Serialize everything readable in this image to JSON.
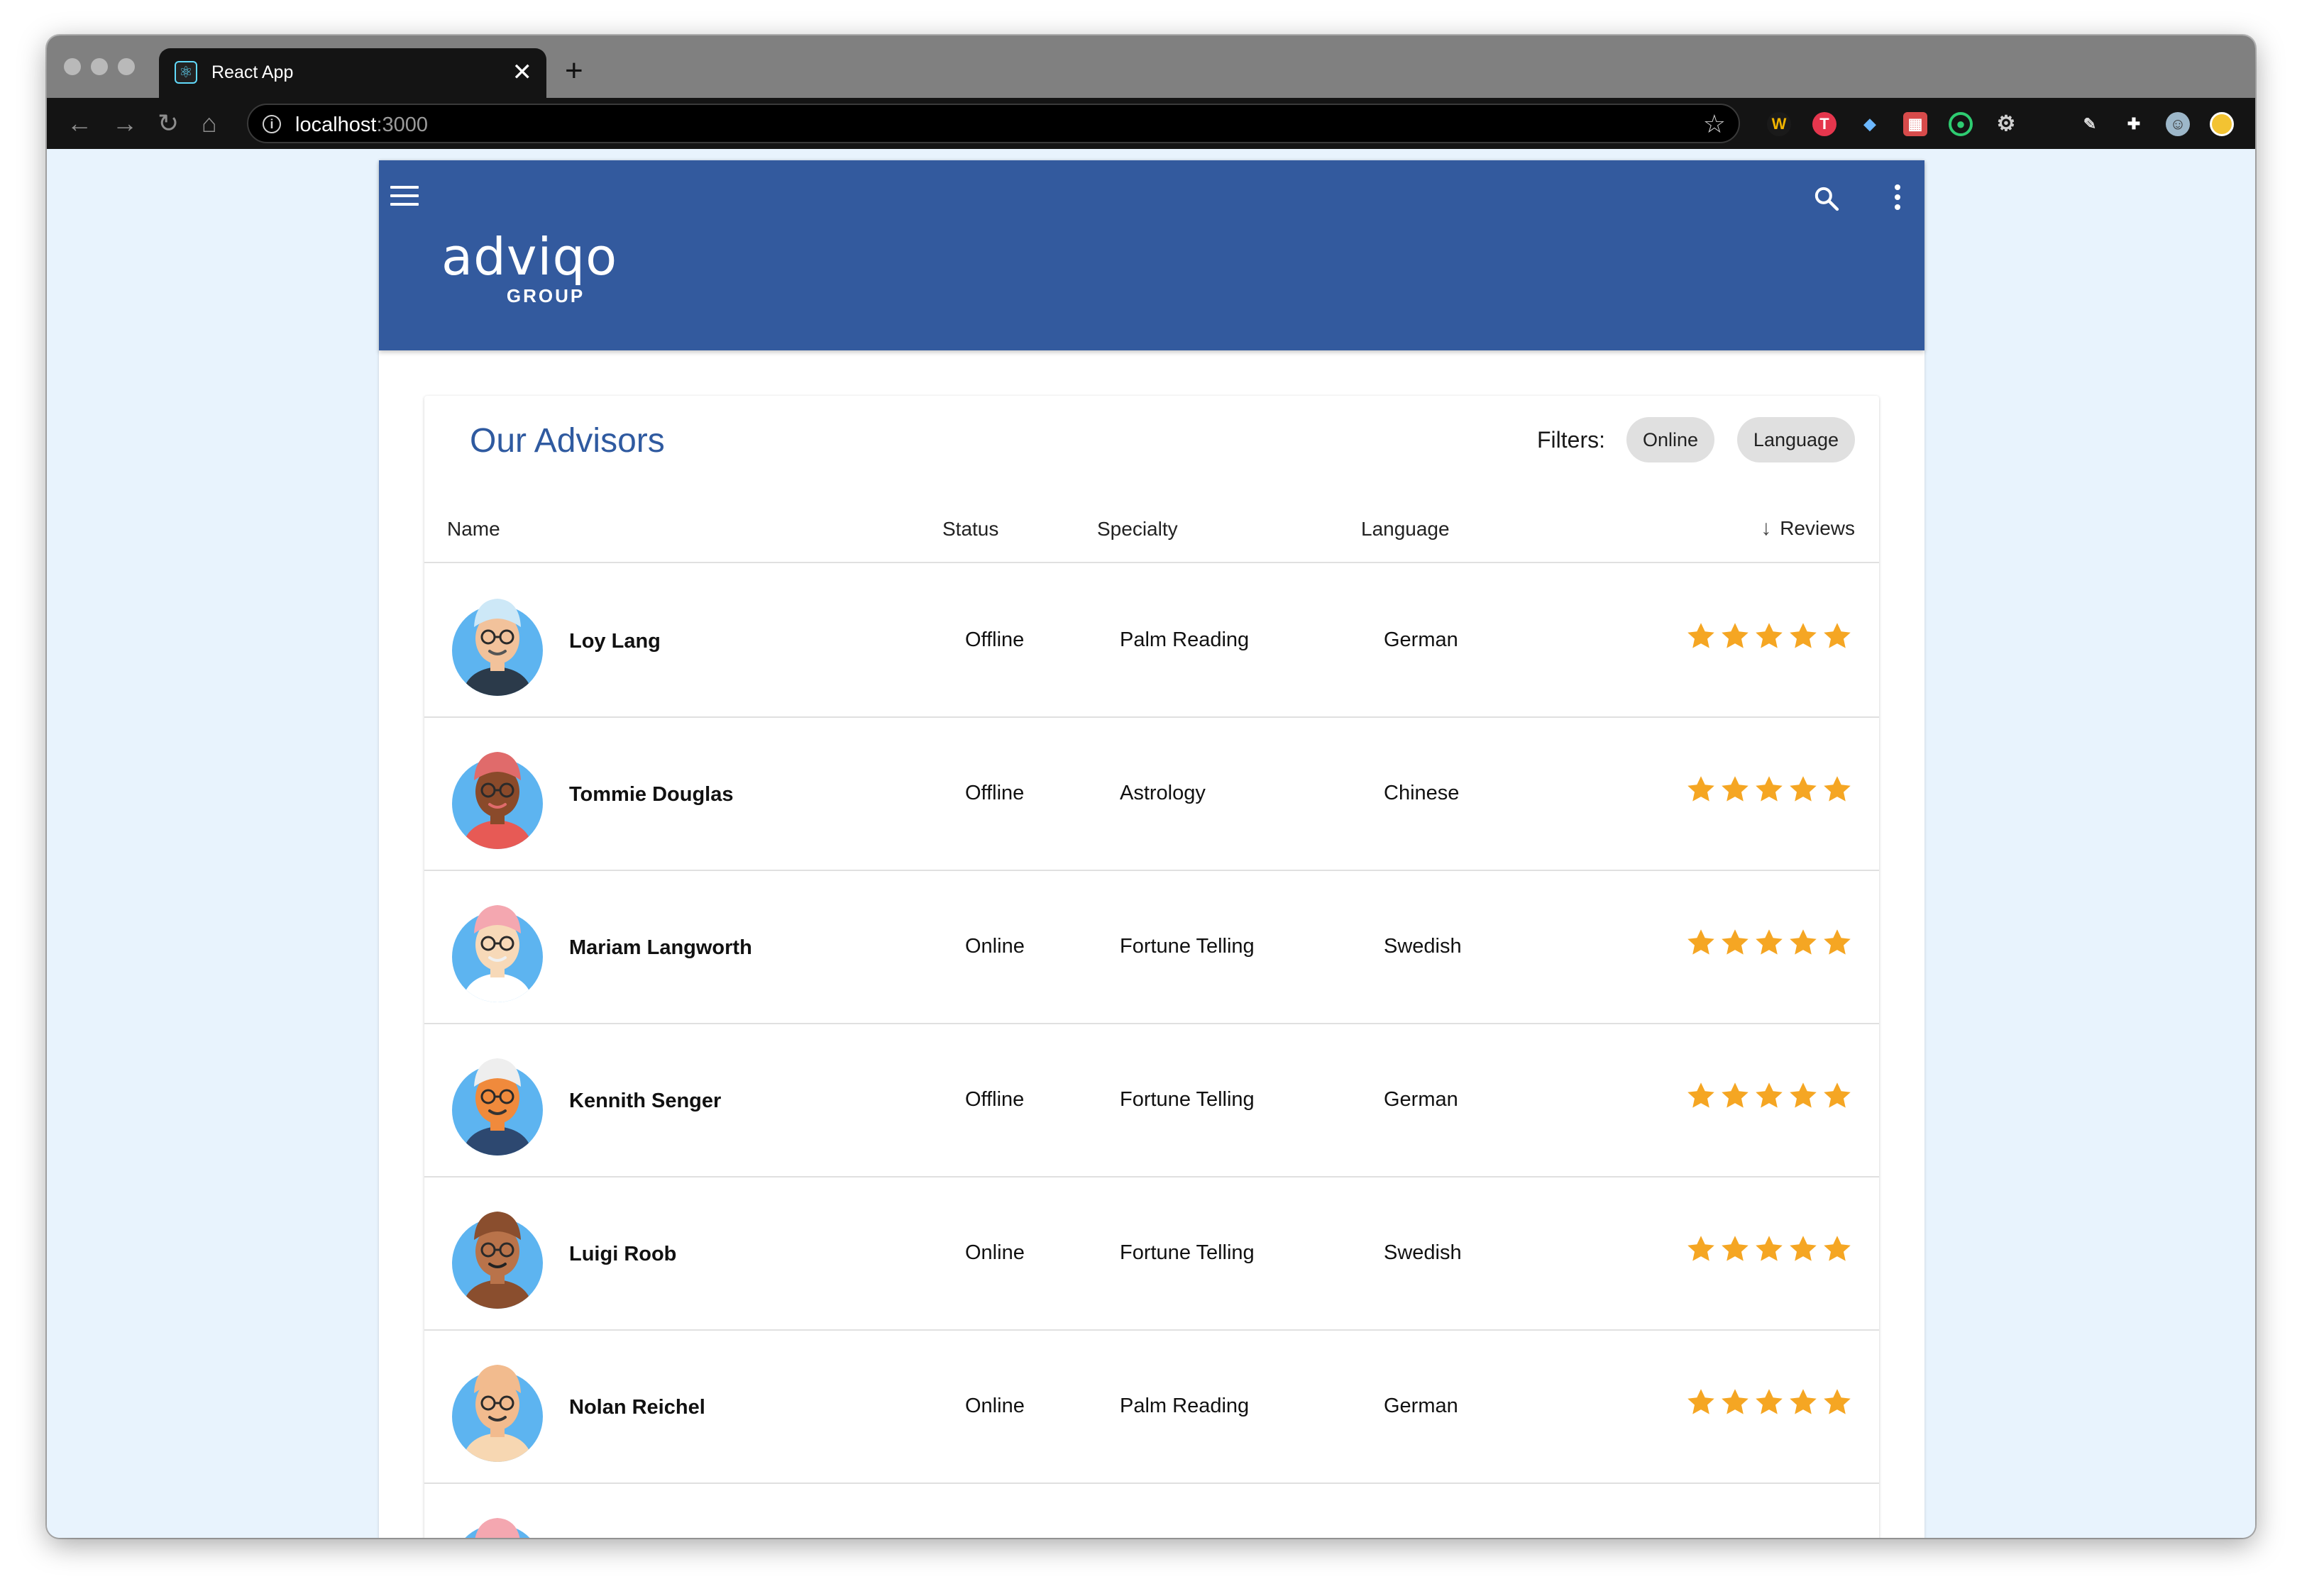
{
  "browser": {
    "tab_title": "React App",
    "tab_close": "✕",
    "new_tab": "+",
    "url_host": "localhost",
    "url_port": ":3000",
    "nav": {
      "back": "←",
      "forward": "→",
      "reload": "↻",
      "home": "⌂"
    }
  },
  "app": {
    "logo_main": "adviqo",
    "logo_sub": "GROUP"
  },
  "card": {
    "title": "Our Advisors",
    "filters_label": "Filters:",
    "chips": [
      "Online",
      "Language"
    ]
  },
  "table": {
    "headers": {
      "name": "Name",
      "status": "Status",
      "specialty": "Specialty",
      "language": "Language",
      "reviews": "Reviews"
    },
    "rows": [
      {
        "name": "Loy Lang",
        "status": "Offline",
        "specialty": "Palm Reading",
        "language": "German",
        "stars": 5,
        "skin": "#f2c29b",
        "hat": "#cde8f7",
        "shirt": "#2b3a4a",
        "hair": "#555555"
      },
      {
        "name": "Tommie Douglas",
        "status": "Offline",
        "specialty": "Astrology",
        "language": "Chinese",
        "stars": 5,
        "skin": "#8a4a2a",
        "hat": "#e06b6b",
        "shirt": "#e75a55",
        "hair": "#e06b6b"
      },
      {
        "name": "Mariam Langworth",
        "status": "Online",
        "specialty": "Fortune Telling",
        "language": "Swedish",
        "stars": 5,
        "skin": "#f7d9b8",
        "hat": "#f4a7b0",
        "shirt": "#ffffff",
        "hair": "#f0f0f0"
      },
      {
        "name": "Kennith Senger",
        "status": "Offline",
        "specialty": "Fortune Telling",
        "language": "German",
        "stars": 5,
        "skin": "#f08a3c",
        "hat": "#eeeeee",
        "shirt": "#2d4870",
        "hair": "#333333"
      },
      {
        "name": "Luigi Roob",
        "status": "Online",
        "specialty": "Fortune Telling",
        "language": "Swedish",
        "stars": 5,
        "skin": "#b9734a",
        "hat": "#8a4e2e",
        "shirt": "#8a4e2e",
        "hair": "#222222"
      },
      {
        "name": "Nolan Reichel",
        "status": "Online",
        "specialty": "Palm Reading",
        "language": "German",
        "stars": 5,
        "skin": "#f2bb8e",
        "hat": "#f2bb8e",
        "shirt": "#f7d7b2",
        "hair": "#333333"
      },
      {
        "name": "",
        "status": "",
        "specialty": "",
        "language": "",
        "stars": 0,
        "skin": "#f7d9b8",
        "hat": "#f4a7b0",
        "shirt": "#ffffff",
        "hair": "#f4a7b0"
      }
    ]
  },
  "colors": {
    "appbar": "#335a9e",
    "title": "#2f5aa0",
    "star": "#f5a623",
    "avatar_bg": "#5db4f0",
    "page_bg": "#e8f3fd"
  }
}
